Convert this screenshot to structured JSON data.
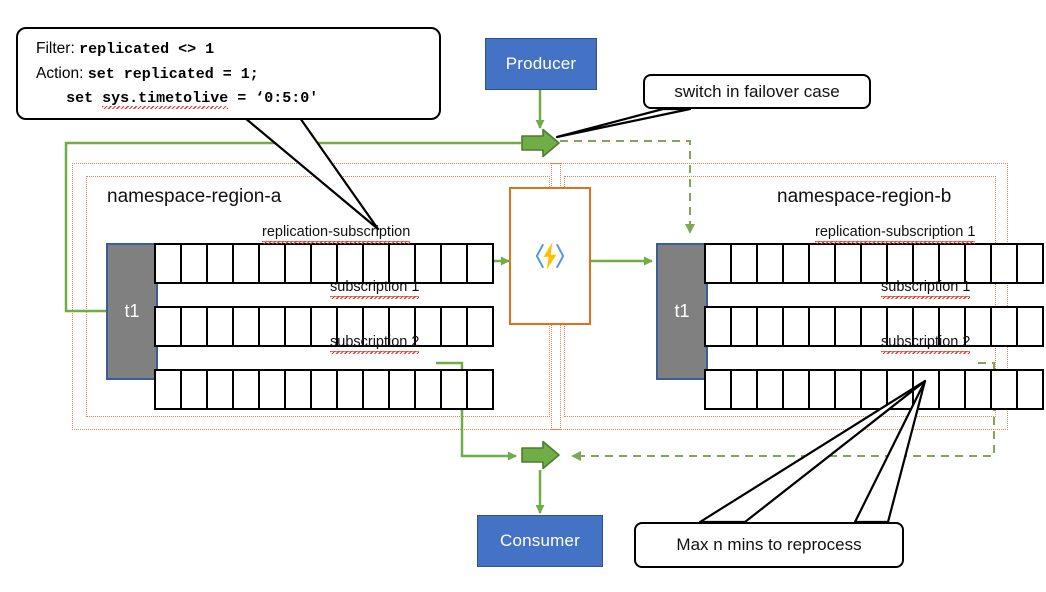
{
  "diagram": {
    "title": "Service Bus geo-replication failover diagram",
    "colors": {
      "endpoint_blue": "#4472C4",
      "endpoint_border": "#2F528F",
      "topic_gray": "#808080",
      "region_dotted_orange": "#E8804A",
      "function_orange": "#E0701A",
      "connector_green": "#70AD47",
      "bolt_yellow": "#FFC000"
    }
  },
  "producer": {
    "label": "Producer"
  },
  "consumer": {
    "label": "Consumer"
  },
  "function_box": {
    "icon": "azure-function-bolt-icon",
    "label": ""
  },
  "callouts": {
    "filter_rule": {
      "line1_label": "Filter:",
      "line1_code": "replicated <> 1",
      "line2_label": "Action:",
      "line2_code": "set replicated = 1;",
      "line3_code_a": "set ",
      "line3_code_b": "sys.timetolive",
      "line3_code_c": " = ‘0:5:0'"
    },
    "switch": {
      "text": "switch in failover case"
    },
    "reprocess": {
      "text": "Max n mins to reprocess"
    }
  },
  "regions": [
    {
      "name": "namespace-region-a",
      "title": "namespace-region-a",
      "topic": {
        "name": "t1"
      },
      "rows": [
        {
          "label": "replication-subscription",
          "cells": 13
        },
        {
          "label": "subscription 1",
          "cells": 13
        },
        {
          "label": "subscription 2",
          "cells": 13
        }
      ]
    },
    {
      "name": "namespace-region-b",
      "title": "namespace-region-b",
      "topic": {
        "name": "t1"
      },
      "rows": [
        {
          "label": "replication-subscription 1",
          "cells": 13
        },
        {
          "label": "subscription 1",
          "cells": 13
        },
        {
          "label": "subscription 2",
          "cells": 13
        }
      ]
    }
  ],
  "connectors": {
    "top_arrow": "producer-routing-arrow",
    "bottom_arrow": "consumer-routing-arrow",
    "dashed_note": "failover path (dashed green)"
  }
}
